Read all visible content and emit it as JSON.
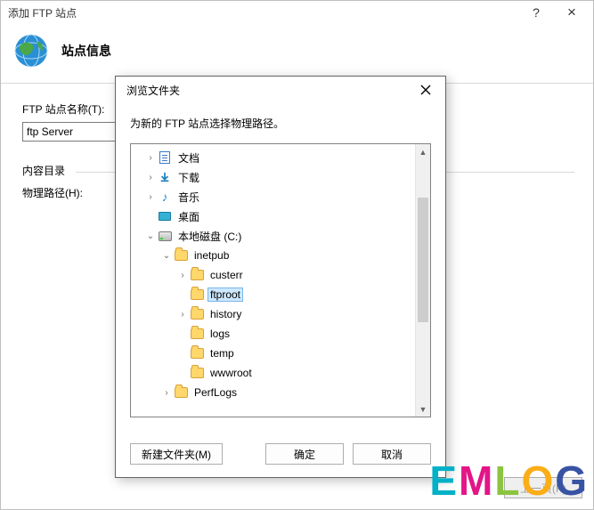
{
  "parent": {
    "title": "添加 FTP 站点",
    "header": "站点信息",
    "site_name_label": "FTP 站点名称(T):",
    "site_name_value": "ftp Server",
    "content_dir_label": "内容目录",
    "phys_label": "物理路径(H):",
    "phys_value": "",
    "buttons": {
      "prev": "上一页(P)"
    }
  },
  "dialog": {
    "title": "浏览文件夹",
    "instruction": "为新的 FTP 站点选择物理路径。",
    "buttons": {
      "new_folder": "新建文件夹(M)",
      "ok": "确定",
      "cancel": "取消"
    },
    "tree": [
      {
        "level": 1,
        "expand": "collapsed",
        "icon": "doc",
        "label": "文档"
      },
      {
        "level": 1,
        "expand": "collapsed",
        "icon": "down",
        "label": "下载"
      },
      {
        "level": 1,
        "expand": "collapsed",
        "icon": "music",
        "label": "音乐"
      },
      {
        "level": 1,
        "expand": "none",
        "icon": "desk",
        "label": "桌面"
      },
      {
        "level": 1,
        "expand": "expanded",
        "icon": "disk",
        "label": "本地磁盘 (C:)"
      },
      {
        "level": 2,
        "expand": "expanded",
        "icon": "folder",
        "label": "inetpub"
      },
      {
        "level": 3,
        "expand": "collapsed",
        "icon": "folder",
        "label": "custerr"
      },
      {
        "level": 3,
        "expand": "none",
        "icon": "folder",
        "label": "ftproot",
        "selected": true
      },
      {
        "level": 3,
        "expand": "collapsed",
        "icon": "folder",
        "label": "history"
      },
      {
        "level": 3,
        "expand": "none",
        "icon": "folder",
        "label": "logs"
      },
      {
        "level": 3,
        "expand": "none",
        "icon": "folder",
        "label": "temp"
      },
      {
        "level": 3,
        "expand": "none",
        "icon": "folder",
        "label": "wwwroot"
      },
      {
        "level": 2,
        "expand": "collapsed",
        "icon": "folder",
        "label": "PerfLogs"
      }
    ]
  },
  "watermark": "EMLOG"
}
